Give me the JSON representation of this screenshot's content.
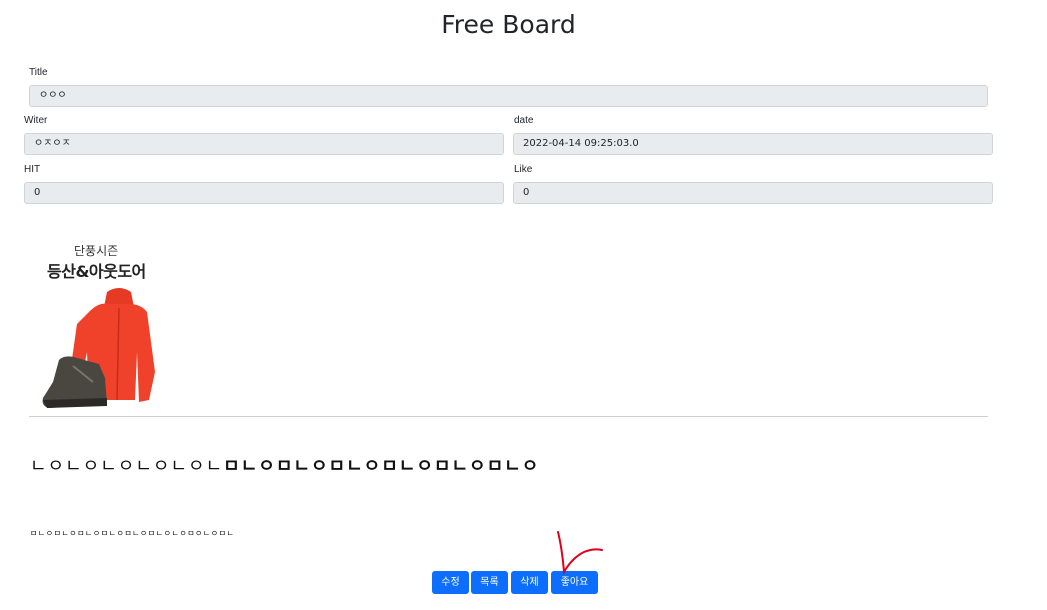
{
  "page": {
    "title": "Free Board"
  },
  "form": {
    "title_label": "Title",
    "title_value": "ㅇㅇㅇ",
    "writer_label": "Witer",
    "writer_value": "ㅇㅈㅇㅈ",
    "date_label": "date",
    "date_value": "2022-04-14 09:25:03.0",
    "hit_label": "HIT",
    "hit_value": "0",
    "like_label": "Like",
    "like_value": "0"
  },
  "promo_image": {
    "line1": "단풍시즌",
    "line2": "등산&아웃도어",
    "jacket_color": "#f0412a",
    "boot_color": "#4a4740"
  },
  "content": {
    "large_plain": "ㄴㅇㄴㅇㄴㅇㄴㅇㄴㅇㄴ",
    "large_bold": "ㅁㄴㅇㅁㄴㅇㅁㄴㅇㅁㄴㅇㅁㄴㅇㅁㄴㅇ",
    "small_text": "ㅁㄴㅇㅁㄴㅇㅁㄴㅇㅁㄴㅇㅁㄴㅇㅁㄴㅇㄴㅇㅁㅇㄴㅇㅁㄴ"
  },
  "actions": {
    "edit_label": "수정",
    "list_label": "목록",
    "delete_label": "삭제",
    "like_label": "좋아요",
    "accent_color": "#0d6efd",
    "annotation_color": "#e0001b"
  }
}
